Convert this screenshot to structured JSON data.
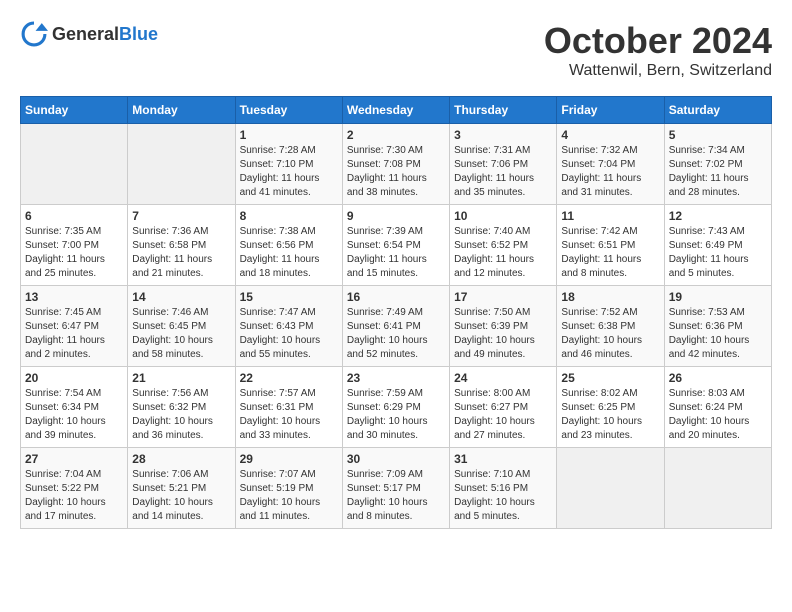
{
  "logo": {
    "general": "General",
    "blue": "Blue"
  },
  "title": {
    "month": "October 2024",
    "location": "Wattenwil, Bern, Switzerland"
  },
  "headers": [
    "Sunday",
    "Monday",
    "Tuesday",
    "Wednesday",
    "Thursday",
    "Friday",
    "Saturday"
  ],
  "weeks": [
    [
      {
        "day": "",
        "info": ""
      },
      {
        "day": "",
        "info": ""
      },
      {
        "day": "1",
        "info": "Sunrise: 7:28 AM\nSunset: 7:10 PM\nDaylight: 11 hours and 41 minutes."
      },
      {
        "day": "2",
        "info": "Sunrise: 7:30 AM\nSunset: 7:08 PM\nDaylight: 11 hours and 38 minutes."
      },
      {
        "day": "3",
        "info": "Sunrise: 7:31 AM\nSunset: 7:06 PM\nDaylight: 11 hours and 35 minutes."
      },
      {
        "day": "4",
        "info": "Sunrise: 7:32 AM\nSunset: 7:04 PM\nDaylight: 11 hours and 31 minutes."
      },
      {
        "day": "5",
        "info": "Sunrise: 7:34 AM\nSunset: 7:02 PM\nDaylight: 11 hours and 28 minutes."
      }
    ],
    [
      {
        "day": "6",
        "info": "Sunrise: 7:35 AM\nSunset: 7:00 PM\nDaylight: 11 hours and 25 minutes."
      },
      {
        "day": "7",
        "info": "Sunrise: 7:36 AM\nSunset: 6:58 PM\nDaylight: 11 hours and 21 minutes."
      },
      {
        "day": "8",
        "info": "Sunrise: 7:38 AM\nSunset: 6:56 PM\nDaylight: 11 hours and 18 minutes."
      },
      {
        "day": "9",
        "info": "Sunrise: 7:39 AM\nSunset: 6:54 PM\nDaylight: 11 hours and 15 minutes."
      },
      {
        "day": "10",
        "info": "Sunrise: 7:40 AM\nSunset: 6:52 PM\nDaylight: 11 hours and 12 minutes."
      },
      {
        "day": "11",
        "info": "Sunrise: 7:42 AM\nSunset: 6:51 PM\nDaylight: 11 hours and 8 minutes."
      },
      {
        "day": "12",
        "info": "Sunrise: 7:43 AM\nSunset: 6:49 PM\nDaylight: 11 hours and 5 minutes."
      }
    ],
    [
      {
        "day": "13",
        "info": "Sunrise: 7:45 AM\nSunset: 6:47 PM\nDaylight: 11 hours and 2 minutes."
      },
      {
        "day": "14",
        "info": "Sunrise: 7:46 AM\nSunset: 6:45 PM\nDaylight: 10 hours and 58 minutes."
      },
      {
        "day": "15",
        "info": "Sunrise: 7:47 AM\nSunset: 6:43 PM\nDaylight: 10 hours and 55 minutes."
      },
      {
        "day": "16",
        "info": "Sunrise: 7:49 AM\nSunset: 6:41 PM\nDaylight: 10 hours and 52 minutes."
      },
      {
        "day": "17",
        "info": "Sunrise: 7:50 AM\nSunset: 6:39 PM\nDaylight: 10 hours and 49 minutes."
      },
      {
        "day": "18",
        "info": "Sunrise: 7:52 AM\nSunset: 6:38 PM\nDaylight: 10 hours and 46 minutes."
      },
      {
        "day": "19",
        "info": "Sunrise: 7:53 AM\nSunset: 6:36 PM\nDaylight: 10 hours and 42 minutes."
      }
    ],
    [
      {
        "day": "20",
        "info": "Sunrise: 7:54 AM\nSunset: 6:34 PM\nDaylight: 10 hours and 39 minutes."
      },
      {
        "day": "21",
        "info": "Sunrise: 7:56 AM\nSunset: 6:32 PM\nDaylight: 10 hours and 36 minutes."
      },
      {
        "day": "22",
        "info": "Sunrise: 7:57 AM\nSunset: 6:31 PM\nDaylight: 10 hours and 33 minutes."
      },
      {
        "day": "23",
        "info": "Sunrise: 7:59 AM\nSunset: 6:29 PM\nDaylight: 10 hours and 30 minutes."
      },
      {
        "day": "24",
        "info": "Sunrise: 8:00 AM\nSunset: 6:27 PM\nDaylight: 10 hours and 27 minutes."
      },
      {
        "day": "25",
        "info": "Sunrise: 8:02 AM\nSunset: 6:25 PM\nDaylight: 10 hours and 23 minutes."
      },
      {
        "day": "26",
        "info": "Sunrise: 8:03 AM\nSunset: 6:24 PM\nDaylight: 10 hours and 20 minutes."
      }
    ],
    [
      {
        "day": "27",
        "info": "Sunrise: 7:04 AM\nSunset: 5:22 PM\nDaylight: 10 hours and 17 minutes."
      },
      {
        "day": "28",
        "info": "Sunrise: 7:06 AM\nSunset: 5:21 PM\nDaylight: 10 hours and 14 minutes."
      },
      {
        "day": "29",
        "info": "Sunrise: 7:07 AM\nSunset: 5:19 PM\nDaylight: 10 hours and 11 minutes."
      },
      {
        "day": "30",
        "info": "Sunrise: 7:09 AM\nSunset: 5:17 PM\nDaylight: 10 hours and 8 minutes."
      },
      {
        "day": "31",
        "info": "Sunrise: 7:10 AM\nSunset: 5:16 PM\nDaylight: 10 hours and 5 minutes."
      },
      {
        "day": "",
        "info": ""
      },
      {
        "day": "",
        "info": ""
      }
    ]
  ]
}
